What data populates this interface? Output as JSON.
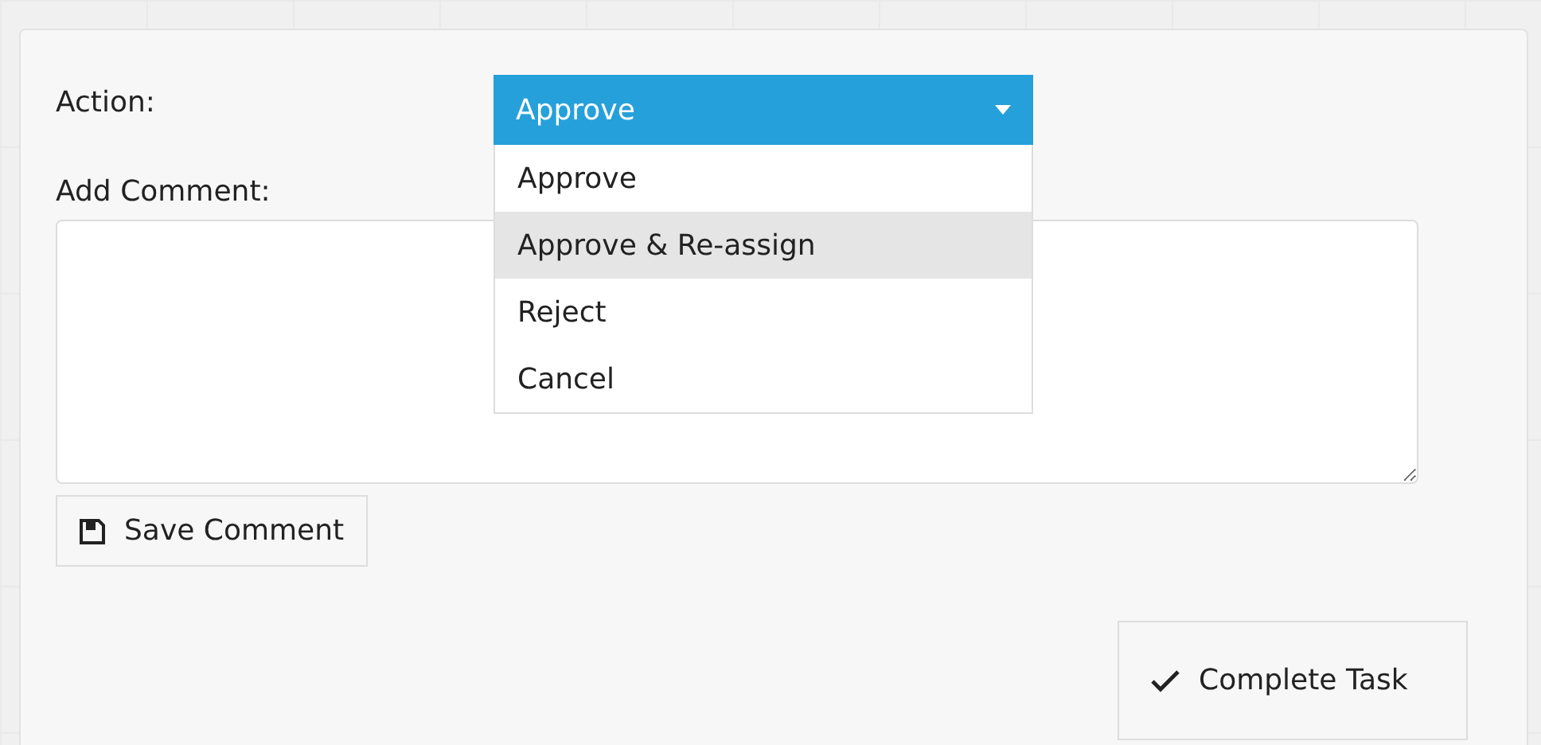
{
  "action": {
    "label": "Action:",
    "value": "Approve",
    "expanded": true,
    "options": [
      {
        "label": "Approve",
        "highlighted": false
      },
      {
        "label": "Approve & Re-assign",
        "highlighted": true
      },
      {
        "label": "Reject",
        "highlighted": false
      },
      {
        "label": "Cancel",
        "highlighted": false
      }
    ]
  },
  "comment": {
    "label": "Add Comment:"
  },
  "buttons": [
    {
      "kind": "save",
      "label": "Save Comment"
    },
    {
      "kind": "complete",
      "label": "Complete Task"
    }
  ]
}
